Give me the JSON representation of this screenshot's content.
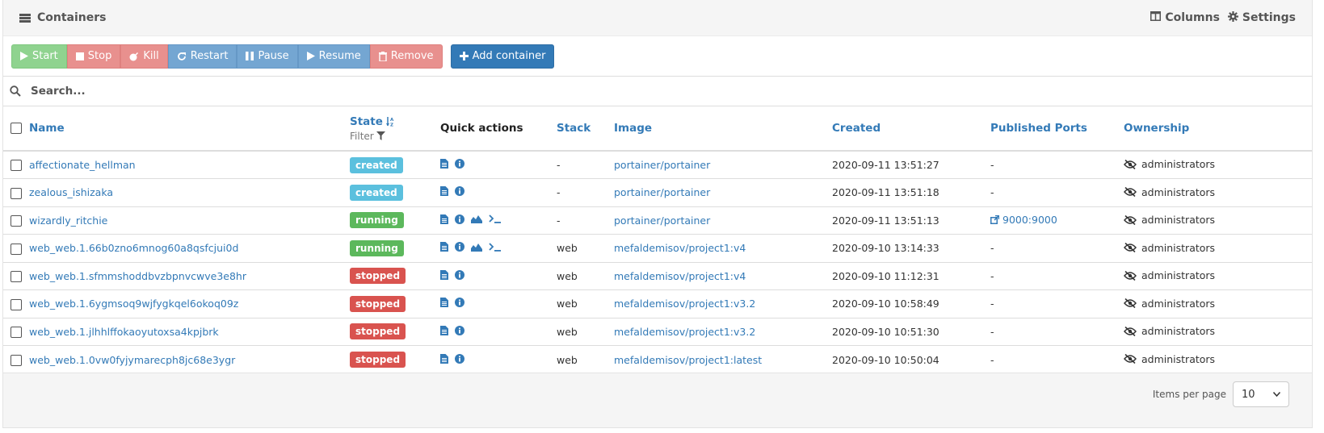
{
  "header": {
    "title": "Containers",
    "columns_label": "Columns",
    "settings_label": "Settings"
  },
  "toolbar": {
    "start": "Start",
    "stop": "Stop",
    "kill": "Kill",
    "restart": "Restart",
    "pause": "Pause",
    "resume": "Resume",
    "remove": "Remove",
    "add": "Add container"
  },
  "search": {
    "placeholder": "Search..."
  },
  "table": {
    "headers": {
      "name": "Name",
      "state": "State",
      "state_filter": "Filter",
      "quick_actions": "Quick actions",
      "stack": "Stack",
      "image": "Image",
      "created": "Created",
      "ports": "Published Ports",
      "ownership": "Ownership"
    },
    "rows": [
      {
        "name": "affectionate_hellman",
        "state": "created",
        "stack": "-",
        "image": "portainer/portainer",
        "created": "2020-09-11 13:51:27",
        "ports": "-",
        "ownership": "administrators"
      },
      {
        "name": "zealous_ishizaka",
        "state": "created",
        "stack": "-",
        "image": "portainer/portainer",
        "created": "2020-09-11 13:51:18",
        "ports": "-",
        "ownership": "administrators"
      },
      {
        "name": "wizardly_ritchie",
        "state": "running",
        "stack": "-",
        "image": "portainer/portainer",
        "created": "2020-09-11 13:51:13",
        "ports": "9000:9000",
        "ownership": "administrators"
      },
      {
        "name": "web_web.1.66b0zno6mnog60a8qsfcjui0d",
        "state": "running",
        "stack": "web",
        "image": "mefaldemisov/project1:v4",
        "created": "2020-09-10 13:14:33",
        "ports": "-",
        "ownership": "administrators"
      },
      {
        "name": "web_web.1.sfmmshoddbvzbpnvcwve3e8hr",
        "state": "stopped",
        "stack": "web",
        "image": "mefaldemisov/project1:v4",
        "created": "2020-09-10 11:12:31",
        "ports": "-",
        "ownership": "administrators"
      },
      {
        "name": "web_web.1.6ygmsoq9wjfygkqel6okoq09z",
        "state": "stopped",
        "stack": "web",
        "image": "mefaldemisov/project1:v3.2",
        "created": "2020-09-10 10:58:49",
        "ports": "-",
        "ownership": "administrators"
      },
      {
        "name": "web_web.1.jlhhlffokaoyutoxsa4kpjbrk",
        "state": "stopped",
        "stack": "web",
        "image": "mefaldemisov/project1:v3.2",
        "created": "2020-09-10 10:51:30",
        "ports": "-",
        "ownership": "administrators"
      },
      {
        "name": "web_web.1.0vw0fyjymarecph8jc68e3ygr",
        "state": "stopped",
        "stack": "web",
        "image": "mefaldemisov/project1:latest",
        "created": "2020-09-10 10:50:04",
        "ports": "-",
        "ownership": "administrators"
      }
    ]
  },
  "footer": {
    "items_per_page_label": "Items per page",
    "items_per_page_value": "10"
  },
  "colors": {
    "link": "#337ab7",
    "created": "#5bc0de",
    "running": "#5cb85c",
    "stopped": "#d9534f"
  }
}
